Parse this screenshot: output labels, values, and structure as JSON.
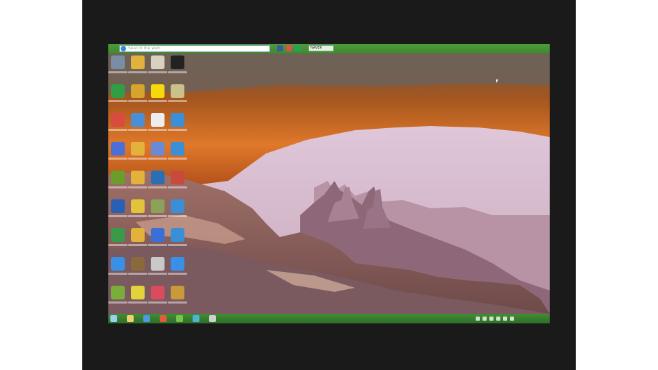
{
  "toolbar": {
    "search_placeholder": "Search the web",
    "button_label": "NAVER"
  },
  "taskbar": {
    "time": "",
    "date": ""
  },
  "colors": {
    "toolbar_green": "#4f9a3a",
    "taskbar_green": "#3f8e35",
    "letterbox": "#1a1a1a"
  },
  "desktop_icons": [
    {
      "name": "recycle-bin-icon",
      "color": "#7b8da5"
    },
    {
      "name": "folder-icon",
      "color": "#e3b23c"
    },
    {
      "name": "app-icon",
      "color": "#d9d0c2"
    },
    {
      "name": "app-icon",
      "color": "#222222"
    },
    {
      "name": "utorrent-icon",
      "color": "#2f9e44"
    },
    {
      "name": "app-icon",
      "color": "#d6a32b"
    },
    {
      "name": "kakaotalk-icon",
      "color": "#f5d90a"
    },
    {
      "name": "app-icon",
      "color": "#c9c08a"
    },
    {
      "name": "chrome-icon",
      "color": "#d94b3d"
    },
    {
      "name": "app-icon",
      "color": "#4a8fd6"
    },
    {
      "name": "document-icon",
      "color": "#eeeeee"
    },
    {
      "name": "globe-icon",
      "color": "#3a8fd6"
    },
    {
      "name": "app-icon",
      "color": "#4a6fd6"
    },
    {
      "name": "app-icon",
      "color": "#e3b23c"
    },
    {
      "name": "app-icon",
      "color": "#6a8ad6"
    },
    {
      "name": "globe-icon",
      "color": "#3a8fd6"
    },
    {
      "name": "nvidia-icon",
      "color": "#6a9d2a"
    },
    {
      "name": "app-icon",
      "color": "#e3b23c"
    },
    {
      "name": "app-icon",
      "color": "#2a6fb6"
    },
    {
      "name": "app-icon",
      "color": "#c94a3d"
    },
    {
      "name": "app-icon",
      "color": "#2a5fb6"
    },
    {
      "name": "app-icon",
      "color": "#e3c23c"
    },
    {
      "name": "app-icon",
      "color": "#8aa25a"
    },
    {
      "name": "globe-icon",
      "color": "#3a8fd6"
    },
    {
      "name": "app-icon",
      "color": "#3a9a4a"
    },
    {
      "name": "app-icon",
      "color": "#e3b23c"
    },
    {
      "name": "app-icon",
      "color": "#3a6fd6"
    },
    {
      "name": "globe-icon",
      "color": "#3a8fd6"
    },
    {
      "name": "app-icon",
      "color": "#3a8fe6"
    },
    {
      "name": "app-icon",
      "color": "#8a6a3c"
    },
    {
      "name": "app-icon",
      "color": "#c9c9c9"
    },
    {
      "name": "app-icon",
      "color": "#3a8fe6"
    },
    {
      "name": "app-icon",
      "color": "#7aae3a"
    },
    {
      "name": "app-icon",
      "color": "#e3d23c"
    },
    {
      "name": "app-icon",
      "color": "#d94b5d"
    },
    {
      "name": "app-icon",
      "color": "#c99a3a"
    }
  ],
  "taskbar_icons": [
    {
      "name": "start-icon",
      "color": "#9ad0f0"
    },
    {
      "name": "folder-icon",
      "color": "#f0d070"
    },
    {
      "name": "ie-icon",
      "color": "#4a9ae6"
    },
    {
      "name": "chrome-icon",
      "color": "#e35b3d"
    },
    {
      "name": "app-icon",
      "color": "#7ac24a"
    },
    {
      "name": "app-icon",
      "color": "#4ab6d6"
    },
    {
      "name": "app-icon",
      "color": "#d0d0d0"
    }
  ]
}
